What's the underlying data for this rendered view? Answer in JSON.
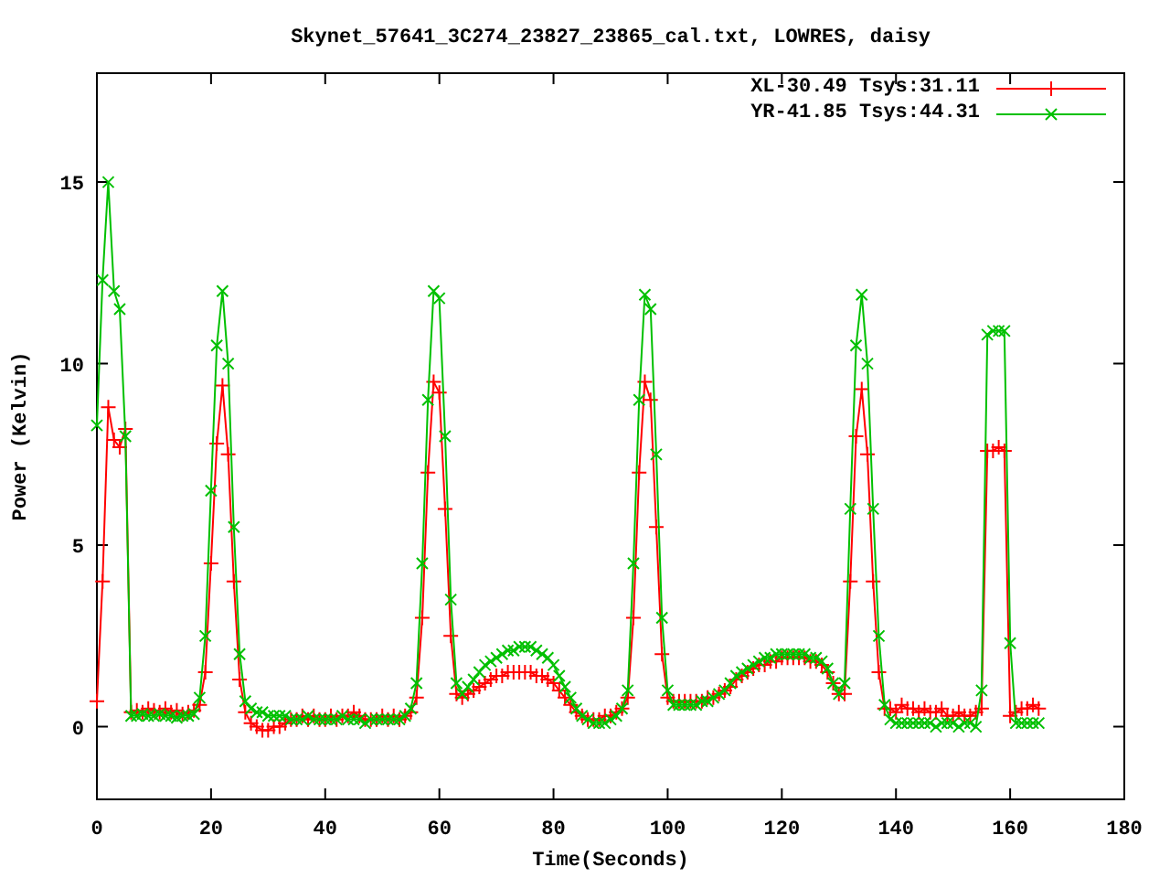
{
  "chart_data": {
    "type": "line",
    "title": "Skynet_57641_3C274_23827_23865_cal.txt, LOWRES, daisy",
    "xlabel": "Time(Seconds)",
    "ylabel": "Power (Kelvin)",
    "xlim": [
      0,
      180
    ],
    "ylim": [
      -2,
      18
    ],
    "xticks": [
      0,
      20,
      40,
      60,
      80,
      100,
      120,
      140,
      160,
      180
    ],
    "yticks": [
      0,
      5,
      10,
      15
    ],
    "x": [
      0,
      1,
      2,
      3,
      4,
      5,
      6,
      7,
      8,
      9,
      10,
      11,
      12,
      13,
      14,
      15,
      16,
      17,
      18,
      19,
      20,
      21,
      22,
      23,
      24,
      25,
      26,
      27,
      28,
      29,
      30,
      31,
      32,
      33,
      34,
      35,
      36,
      37,
      38,
      39,
      40,
      41,
      42,
      43,
      44,
      45,
      46,
      47,
      48,
      49,
      50,
      51,
      52,
      53,
      54,
      55,
      56,
      57,
      58,
      59,
      60,
      61,
      62,
      63,
      64,
      65,
      66,
      67,
      68,
      69,
      70,
      71,
      72,
      73,
      74,
      75,
      76,
      77,
      78,
      79,
      80,
      81,
      82,
      83,
      84,
      85,
      86,
      87,
      88,
      89,
      90,
      91,
      92,
      93,
      94,
      95,
      96,
      97,
      98,
      99,
      100,
      101,
      102,
      103,
      104,
      105,
      106,
      107,
      108,
      109,
      110,
      111,
      112,
      113,
      114,
      115,
      116,
      117,
      118,
      119,
      120,
      121,
      122,
      123,
      124,
      125,
      126,
      127,
      128,
      129,
      130,
      131,
      132,
      133,
      134,
      135,
      136,
      137,
      138,
      139,
      140,
      141,
      142,
      143,
      144,
      145,
      146,
      147,
      148,
      149,
      150,
      151,
      152,
      153,
      154,
      155,
      156,
      157,
      158,
      159,
      160,
      161,
      162,
      163,
      164,
      165
    ],
    "series": [
      {
        "name": "XL-30.49 Tsys:31.11",
        "color": "#ff0000",
        "marker": "plus",
        "values": [
          0.7,
          4,
          8.8,
          7.9,
          7.7,
          8.2,
          0.4,
          0.45,
          0.4,
          0.5,
          0.45,
          0.4,
          0.5,
          0.4,
          0.45,
          0.35,
          0.4,
          0.45,
          0.6,
          1.5,
          4.5,
          7.8,
          9.4,
          7.5,
          4,
          1.3,
          0.4,
          0.1,
          0,
          -0.1,
          -0.1,
          0,
          0,
          0.1,
          0.2,
          0.2,
          0.3,
          0.2,
          0.3,
          0.2,
          0.2,
          0.3,
          0.2,
          0.3,
          0.3,
          0.4,
          0.3,
          0.2,
          0.2,
          0.2,
          0.3,
          0.2,
          0.3,
          0.2,
          0.3,
          0.4,
          0.8,
          3,
          7,
          9.5,
          9.2,
          6,
          2.5,
          0.9,
          0.8,
          0.9,
          1,
          1.1,
          1.2,
          1.3,
          1.4,
          1.4,
          1.5,
          1.5,
          1.5,
          1.5,
          1.5,
          1.4,
          1.4,
          1.3,
          1.2,
          1,
          0.8,
          0.6,
          0.4,
          0.3,
          0.2,
          0.2,
          0.2,
          0.3,
          0.3,
          0.4,
          0.5,
          0.8,
          3,
          7,
          9.5,
          9,
          5.5,
          2,
          0.8,
          0.7,
          0.7,
          0.7,
          0.7,
          0.7,
          0.7,
          0.8,
          0.8,
          0.9,
          1,
          1.1,
          1.3,
          1.4,
          1.5,
          1.6,
          1.7,
          1.7,
          1.8,
          1.8,
          1.9,
          1.9,
          1.9,
          1.9,
          1.9,
          1.8,
          1.8,
          1.7,
          1.5,
          1.2,
          0.9,
          0.9,
          4,
          8,
          9.3,
          7.5,
          4,
          1.5,
          0.5,
          0.5,
          0.4,
          0.6,
          0.5,
          0.5,
          0.4,
          0.5,
          0.4,
          0.4,
          0.5,
          0.3,
          0.3,
          0.4,
          0.3,
          0.3,
          0.4,
          0.5,
          7.6,
          7.6,
          7.7,
          7.6,
          0.3,
          0.4,
          0.5,
          0.5,
          0.6,
          0.5
        ]
      },
      {
        "name": "YR-41.85 Tsys:44.31",
        "color": "#00c000",
        "marker": "cross",
        "values": [
          8.3,
          12.3,
          15,
          12,
          11.5,
          8,
          0.3,
          0.3,
          0.35,
          0.3,
          0.3,
          0.35,
          0.3,
          0.3,
          0.25,
          0.3,
          0.3,
          0.35,
          0.8,
          2.5,
          6.5,
          10.5,
          12,
          10,
          5.5,
          2,
          0.7,
          0.5,
          0.4,
          0.4,
          0.3,
          0.3,
          0.3,
          0.3,
          0.2,
          0.2,
          0.2,
          0.3,
          0.2,
          0.2,
          0.2,
          0.2,
          0.2,
          0.3,
          0.2,
          0.2,
          0.2,
          0.1,
          0.2,
          0.2,
          0.2,
          0.2,
          0.2,
          0.2,
          0.3,
          0.5,
          1.2,
          4.5,
          9,
          12,
          11.8,
          8,
          3.5,
          1.2,
          0.9,
          1.1,
          1.3,
          1.5,
          1.7,
          1.8,
          1.9,
          2,
          2.1,
          2.1,
          2.2,
          2.2,
          2.2,
          2.1,
          2,
          1.9,
          1.7,
          1.4,
          1.1,
          0.8,
          0.5,
          0.3,
          0.2,
          0.1,
          0.1,
          0.1,
          0.2,
          0.3,
          0.5,
          1,
          4.5,
          9,
          11.9,
          11.5,
          7.5,
          3,
          1,
          0.6,
          0.6,
          0.6,
          0.6,
          0.6,
          0.7,
          0.7,
          0.8,
          0.9,
          1,
          1.2,
          1.4,
          1.5,
          1.6,
          1.7,
          1.8,
          1.9,
          1.9,
          2,
          2,
          2,
          2,
          2,
          2,
          1.9,
          1.9,
          1.8,
          1.6,
          1.2,
          0.9,
          1.2,
          6,
          10.5,
          11.9,
          10,
          6,
          2.5,
          0.6,
          0.2,
          0.1,
          0.1,
          0.1,
          0.1,
          0.1,
          0.1,
          0.1,
          0,
          0.1,
          0.1,
          0.1,
          0,
          0.1,
          0.1,
          0,
          1,
          10.8,
          10.9,
          10.9,
          10.9,
          2.3,
          0.1,
          0.1,
          0.1,
          0.1,
          0.1
        ]
      }
    ]
  }
}
